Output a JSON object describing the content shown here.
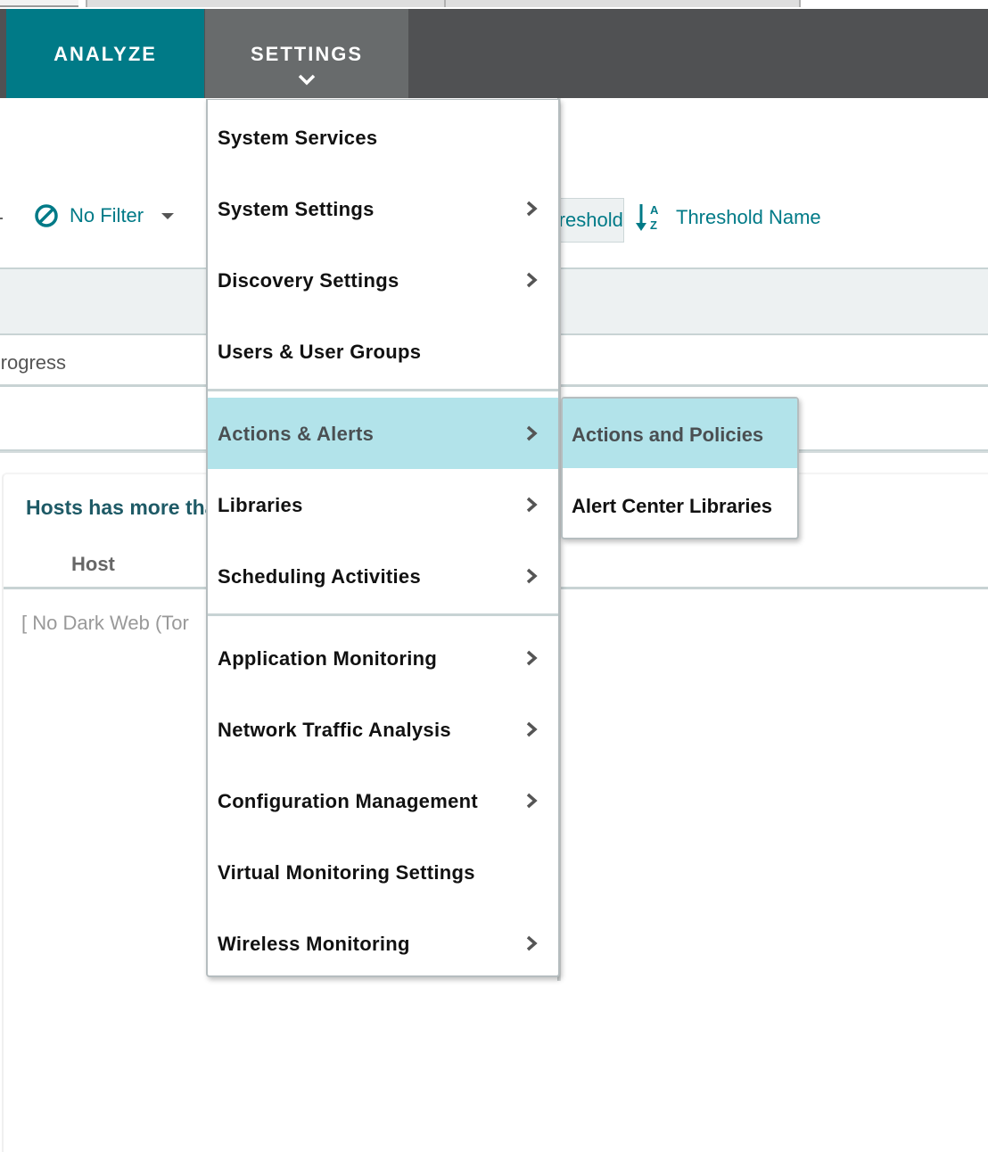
{
  "nav": {
    "analyze_label": "ANALYZE",
    "settings_label": "SETTINGS",
    "active_color": "#007a87",
    "open_color": "#686b6c"
  },
  "toolbar": {
    "filter_label": "No Filter",
    "threshold_btn_label": "Threshold",
    "sort_label": "Threshold Name"
  },
  "background": {
    "progress_text": "Progress",
    "panel_title": "Hosts has more than",
    "column_header": "Host",
    "empty_message": "[ No Dark Web (Tor"
  },
  "settings_menu": {
    "items": [
      {
        "label": "System Services",
        "has_submenu": false
      },
      {
        "label": "System Settings",
        "has_submenu": true
      },
      {
        "label": "Discovery Settings",
        "has_submenu": true
      },
      {
        "label": "Users & User Groups",
        "has_submenu": false
      },
      {
        "label": "Actions & Alerts",
        "has_submenu": true,
        "active": true
      },
      {
        "label": "Libraries",
        "has_submenu": true
      },
      {
        "label": "Scheduling Activities",
        "has_submenu": true
      },
      {
        "label": "Application Monitoring",
        "has_submenu": true
      },
      {
        "label": "Network Traffic Analysis",
        "has_submenu": true
      },
      {
        "label": "Configuration Management",
        "has_submenu": true
      },
      {
        "label": "Virtual Monitoring Settings",
        "has_submenu": false
      },
      {
        "label": "Wireless Monitoring",
        "has_submenu": true
      }
    ]
  },
  "submenu": {
    "items": [
      {
        "label": "Actions and Policies",
        "active": true
      },
      {
        "label": "Alert Center Libraries"
      }
    ]
  },
  "colors": {
    "accent": "#007a87",
    "highlight": "#b2e3ea",
    "navbar": "#505153"
  }
}
